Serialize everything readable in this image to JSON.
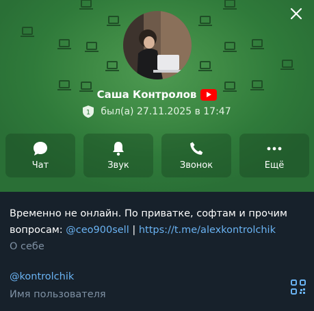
{
  "profile": {
    "name": "Саша Контролов",
    "status_badge": "1",
    "last_seen": "был(а) 27.11.2025 в 17:47"
  },
  "actions": [
    {
      "label": "Чат",
      "icon": "chat-bubble-icon"
    },
    {
      "label": "Звук",
      "icon": "bell-icon"
    },
    {
      "label": "Звонок",
      "icon": "phone-icon"
    },
    {
      "label": "Ещё",
      "icon": "more-dots-icon"
    }
  ],
  "info": {
    "bio_text": "Временно не онлайн. По приватке, софтам и прочим вопросам: ",
    "bio_mention": "@ceo900sell",
    "bio_sep": " | ",
    "bio_link": "https://t.me/alexkontrolchik",
    "bio_caption": "О себе",
    "username": "@kontrolchik",
    "username_caption": "Имя пользователя"
  },
  "colors": {
    "header_green": "#3f8b45",
    "background": "#17212b",
    "link": "#6ab3f3",
    "muted": "#7f91a4"
  }
}
